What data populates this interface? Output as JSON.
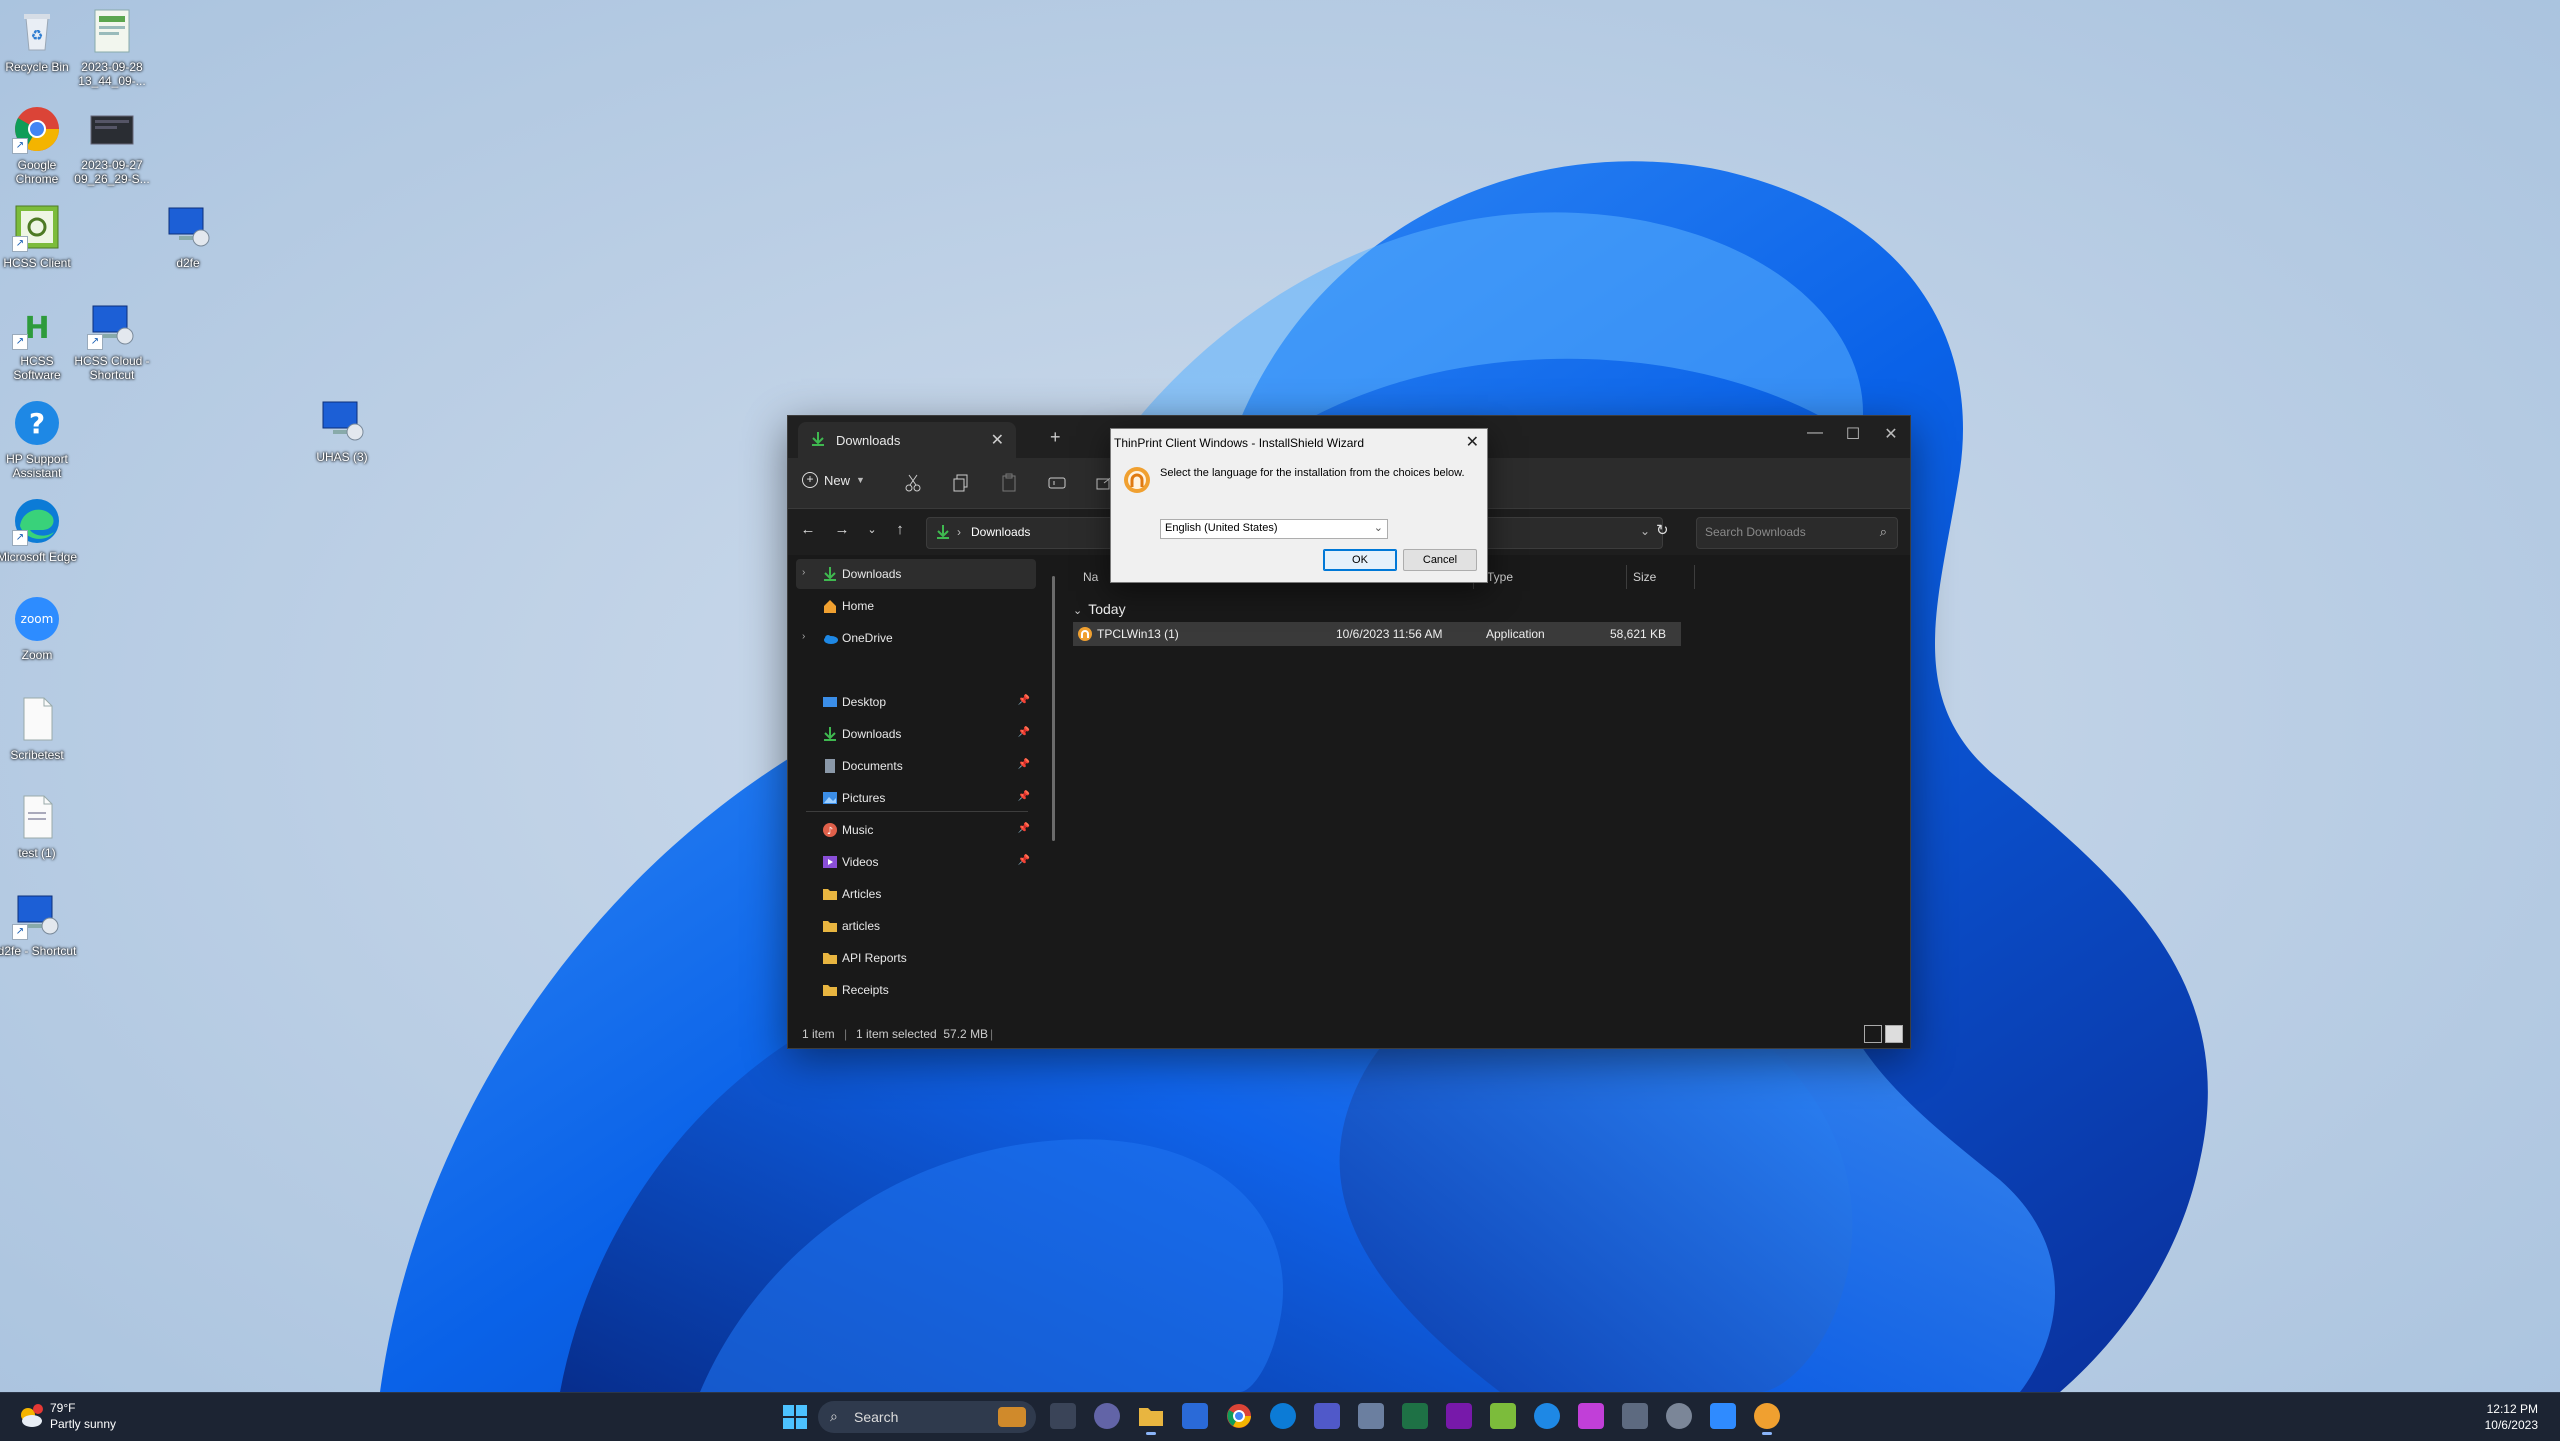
{
  "desktop": {
    "icons": [
      {
        "label": "Recycle Bin"
      },
      {
        "label": "2023-09-28 13_44_09-..."
      },
      {
        "label": "Google Chrome"
      },
      {
        "label": "2023-09-27 09_26_29-S..."
      },
      {
        "label": "HCSS Client"
      },
      {
        "label": "d2fe"
      },
      {
        "label": "HCSS Software"
      },
      {
        "label": "HCSS Cloud - Shortcut"
      },
      {
        "label": "UHAS (3)"
      },
      {
        "label": "HP Support Assistant"
      },
      {
        "label": "Microsoft Edge"
      },
      {
        "label": "Zoom"
      },
      {
        "label": "Scribetest"
      },
      {
        "label": "test (1)"
      },
      {
        "label": "d2fe - Shortcut"
      }
    ]
  },
  "explorer": {
    "tab_title": "Downloads",
    "toolbar": {
      "new_label": "New"
    },
    "address": {
      "path": "Downloads"
    },
    "search": {
      "placeholder": "Search Downloads"
    },
    "nav": {
      "top_items": [
        {
          "label": "Downloads"
        },
        {
          "label": "Home"
        },
        {
          "label": "OneDrive"
        }
      ],
      "quick_access": [
        {
          "label": "Desktop"
        },
        {
          "label": "Downloads"
        },
        {
          "label": "Documents"
        },
        {
          "label": "Pictures"
        },
        {
          "label": "Music"
        },
        {
          "label": "Videos"
        },
        {
          "label": "Articles"
        },
        {
          "label": "articles"
        },
        {
          "label": "API Reports"
        },
        {
          "label": "Receipts"
        }
      ]
    },
    "columns": {
      "name": "Na",
      "type": "Type",
      "size": "Size"
    },
    "group": "Today",
    "files": [
      {
        "name": "TPCLWin13 (1)",
        "date": "10/6/2023 11:56 AM",
        "type": "Application",
        "size": "58,621 KB"
      }
    ],
    "status": {
      "count": "1 item",
      "selected": "1 item selected  57.2 MB"
    }
  },
  "dialog": {
    "title": "ThinPrint Client Windows - InstallShield Wizard",
    "message": "Select the language for the installation from the choices below.",
    "language": "English (United States)",
    "ok": "OK",
    "cancel": "Cancel"
  },
  "taskbar": {
    "weather": {
      "temp": "79°F",
      "condition": "Partly sunny"
    },
    "search_label": "Search",
    "clock": {
      "time": "12:12 PM",
      "date": "10/6/2023"
    }
  },
  "colors": {
    "accent": "#0078d7",
    "folder": "#e8b540",
    "download": "#3fb950"
  }
}
